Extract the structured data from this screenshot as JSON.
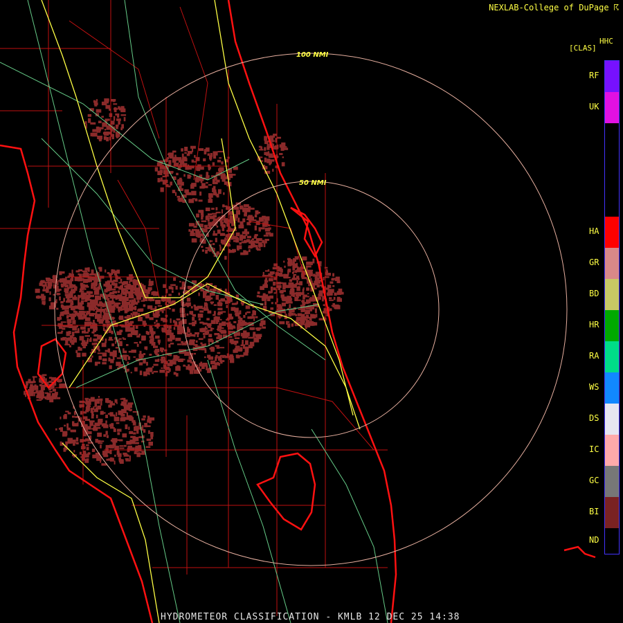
{
  "header": {
    "credit": "NEXLAB-College of DuPage ☈"
  },
  "legend": {
    "title_top": "HHC",
    "title_sub": "[CLAS]",
    "items": [
      {
        "code": "RF",
        "color": "#7711ff"
      },
      {
        "code": "UK",
        "color": "#e111e1"
      },
      {
        "code": "HA",
        "color": "#ff0000"
      },
      {
        "code": "GR",
        "color": "#d98888"
      },
      {
        "code": "BD",
        "color": "#c8c864"
      },
      {
        "code": "HR",
        "color": "#00aa00"
      },
      {
        "code": "RA",
        "color": "#00dd88"
      },
      {
        "code": "WS",
        "color": "#1188ff"
      },
      {
        "code": "DS",
        "color": "#e6e6f0"
      },
      {
        "code": "IC",
        "color": "#ffaaaa"
      },
      {
        "code": "GC",
        "color": "#777777"
      },
      {
        "code": "BI",
        "color": "#7a2222"
      },
      {
        "code": "ND",
        "color": "#000000"
      }
    ]
  },
  "map": {
    "range_rings": [
      {
        "label": "100 NMI"
      },
      {
        "label": "50 NMI"
      }
    ],
    "colors": {
      "coast": "#ff1111",
      "county": "#c01111",
      "highway": "#ffff44",
      "road": "#66cc88",
      "ring": "#e8b0a0",
      "echo": "#8b2a2a"
    }
  },
  "footer": {
    "caption": "HYDROMETEOR CLASSIFICATION - KMLB 12 DEC 25 14:38"
  }
}
